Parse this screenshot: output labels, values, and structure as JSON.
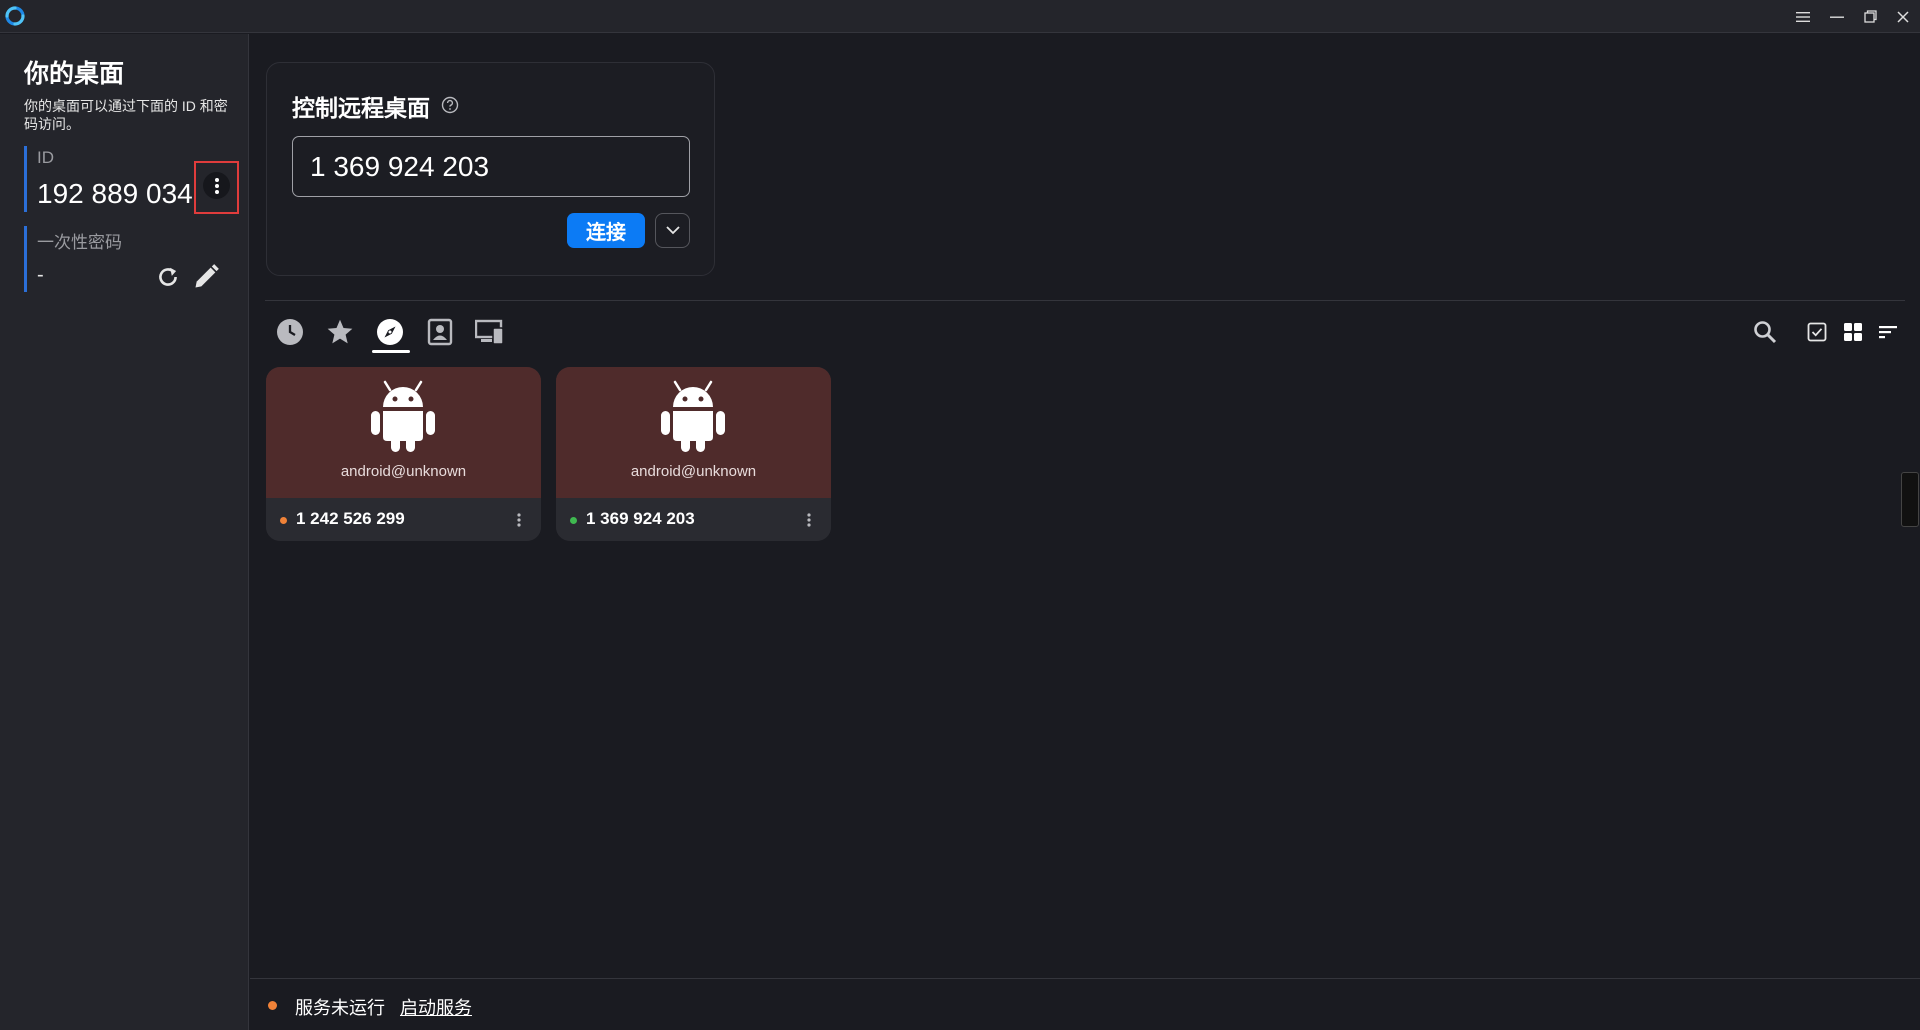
{
  "colors": {
    "accent": "#0c7bf5",
    "id_bar": "#2b6fd8",
    "peer_card_top": "#4f2b2b",
    "status_offline": "#f08238",
    "status_online": "#3fb950",
    "highlight_box": "#e03c3c"
  },
  "titlebar": {
    "icons": [
      "app-logo-icon",
      "hamburger-menu-icon",
      "minimize-icon",
      "restore-icon",
      "close-icon"
    ]
  },
  "left_panel": {
    "title": "你的桌面",
    "description": "你的桌面可以通过下面的 ID 和密码访问。",
    "id_label": "ID",
    "id_value": "192 889 034",
    "password_label": "一次性密码",
    "password_value": "-"
  },
  "remote": {
    "title": "控制远程桌面",
    "input_value": "1 369 924 203",
    "connect_label": "连接"
  },
  "tabs": [
    {
      "icon": "clock-icon",
      "name": "recent"
    },
    {
      "icon": "star-icon",
      "name": "favorites"
    },
    {
      "icon": "compass-icon",
      "name": "discovered",
      "active": true
    },
    {
      "icon": "address-book-icon",
      "name": "address-book"
    },
    {
      "icon": "devices-icon",
      "name": "devices"
    }
  ],
  "peers": [
    {
      "user": "android@unknown",
      "id": "1 242 526 299",
      "status": "offline"
    },
    {
      "user": "android@unknown",
      "id": "1 369 924 203",
      "status": "online"
    }
  ],
  "status": {
    "text": "服务未运行",
    "link": "启动服务"
  }
}
